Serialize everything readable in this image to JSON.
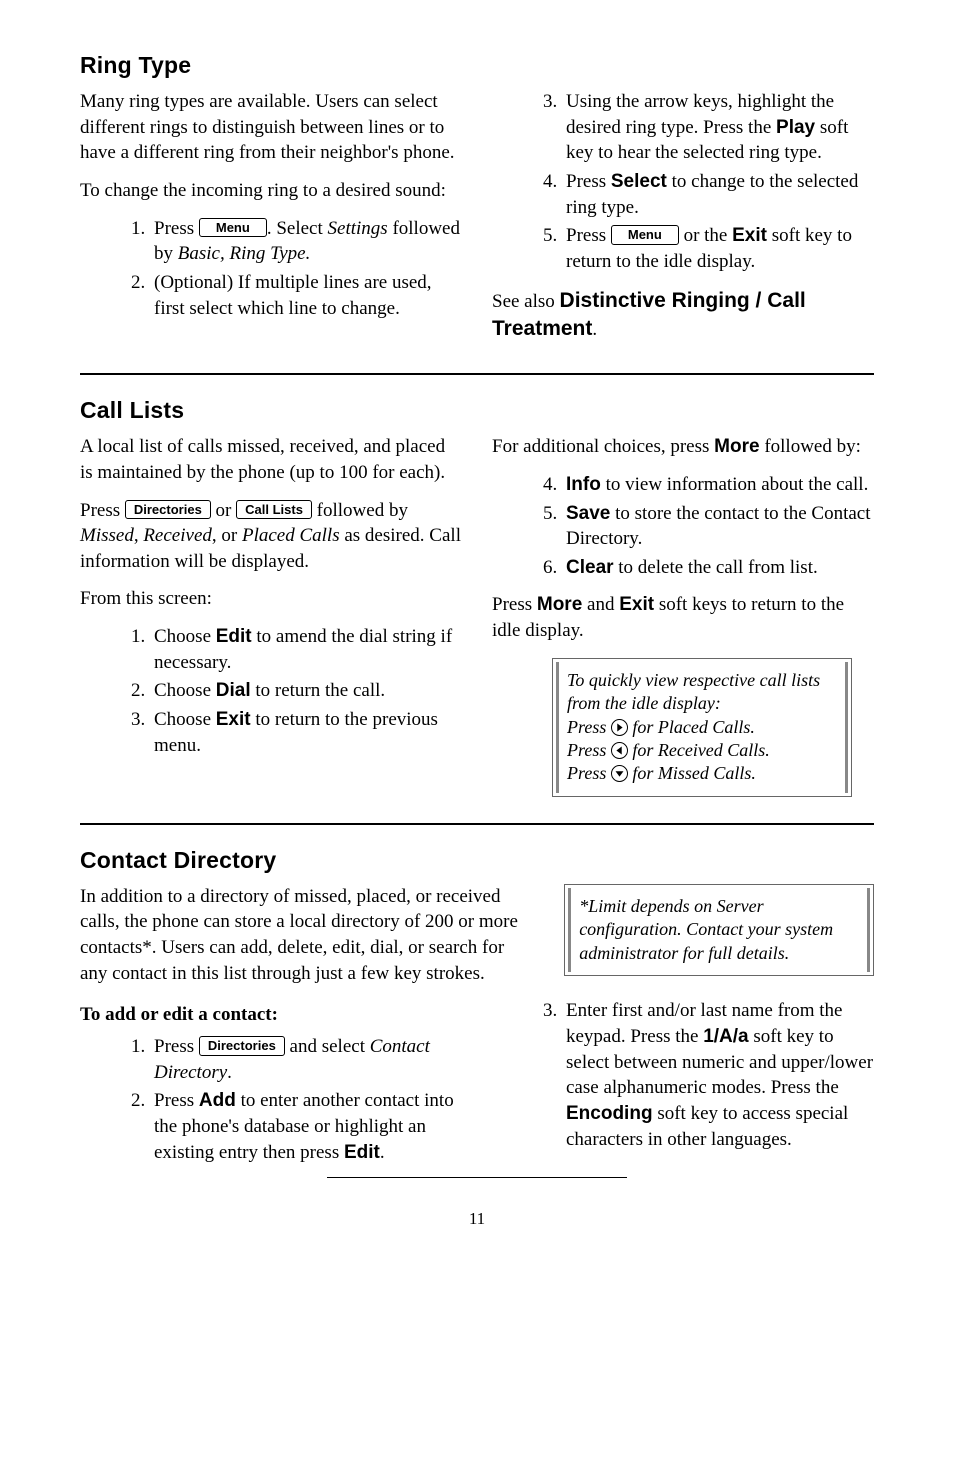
{
  "sec1": {
    "title": "Ring Type",
    "p1": "Many ring types are available.  Users can select different rings to distinguish between lines or to have a different ring from their neighbor's phone.",
    "p2": "To change the incoming ring to a desired sound:",
    "li1a": "Press ",
    "li1_key": "Menu",
    "li1b": ".  Select ",
    "li1_sel": "Settings",
    "li1c": " followed by ",
    "li1_path": "Basic, Ring Type.",
    "li2": "(Optional)  If multiple lines are used, first select which line to change.",
    "li3a": "Using the arrow keys, highlight the desired ring type.  Press the ",
    "li3_sk": "Play",
    "li3b": " soft key to hear the selected ring type.",
    "li4a": "Press ",
    "li4_sk": "Select",
    "li4b": " to change to the selected ring type.",
    "li5a": "Press ",
    "li5_key": "Menu",
    "li5b": " or the ",
    "li5_sk": "Exit",
    "li5c": " soft key to return to the idle display.",
    "see_also_pre": "See also ",
    "see_also": "Distinctive Ringing / Call Treatment"
  },
  "sec2": {
    "title": "Call Lists",
    "p1": "A local list of calls missed, received, and placed is maintained by the phone (up to 100 for each).",
    "p2a": "Press ",
    "p2_key1": "Directories",
    "p2b": " or ",
    "p2_key2": "Call Lists",
    "p2c": " followed by ",
    "p2_miss": "Missed",
    "p2d": ", ",
    "p2_recv": "Received",
    "p2e": ", or ",
    "p2_plac": "Placed Calls",
    "p2f": " as desired.  Call information will be displayed.",
    "p3": "From this screen:",
    "li1a": "Choose ",
    "li1_sk": "Edit",
    "li1b": " to amend the dial string if necessary.",
    "li2a": "Choose ",
    "li2_sk": "Dial",
    "li2b": " to return the call.",
    "li3a": "Choose ",
    "li3_sk": "Exit",
    "li3b": " to return to the previous menu.",
    "p4a": "For additional choices, press ",
    "p4_sk": "More",
    "p4b": " followed by:",
    "li4_sk": "Info",
    "li4b": " to view information about the call.",
    "li5_sk": "Save",
    "li5b": " to store the contact to the Contact Directory.",
    "li6_sk": "Clear",
    "li6b": " to delete the call from list.",
    "p5a": "Press ",
    "p5_sk1": "More",
    "p5b": " and ",
    "p5_sk2": "Exit",
    "p5c": " soft keys to return to the idle display.",
    "tip_l1": "To quickly view respective call lists from the idle display:",
    "tip_l2a": "Press ",
    "tip_l2b": " for Placed Calls.",
    "tip_l3a": "Press ",
    "tip_l3b": " for Received Calls.",
    "tip_l4a": "Press ",
    "tip_l4b": " for Missed Calls."
  },
  "sec3": {
    "title": "Contact Directory",
    "p1": "In addition to a directory of missed, placed, or received calls, the phone can store a local directory of 200 or more contacts*.  Users can add, delete, edit, dial,  or search for any contact in this list through just a few key strokes.",
    "note": "*Limit depends on Server configuration.  Contact your system administrator for full details.",
    "sub": "To add or edit a contact:",
    "li1a": "Press ",
    "li1_key": "Directories",
    "li1b": " and select ",
    "li1_sel": "Contact Directory",
    "li1c": ".",
    "li2a": "Press ",
    "li2_sk": "Add",
    "li2b": " to enter another contact into the phone's database or highlight an existing entry then press ",
    "li2_sk2": "Edit",
    "li2c": ".",
    "li3a": "Enter first and/or last name from the keypad.  Press the ",
    "li3_sk1": "1/A/a",
    "li3b": " soft key to select between numeric and upper/lower case alphanumeric modes. Press the ",
    "li3_sk2": "Encoding",
    "li3c": " soft key to access special characters in other languages."
  },
  "page_num": "11"
}
